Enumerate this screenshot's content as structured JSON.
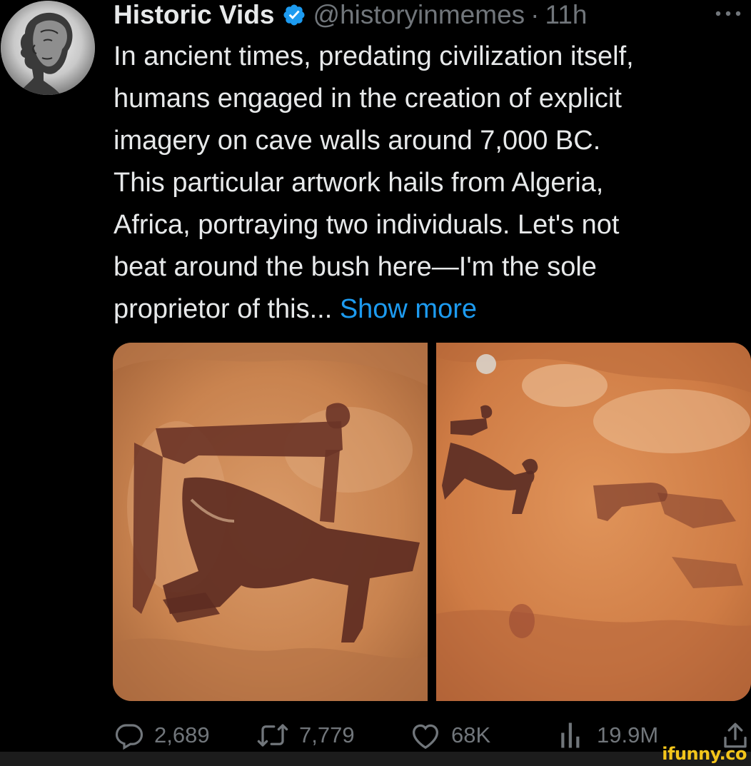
{
  "tweet": {
    "author": {
      "display_name": "Historic Vids",
      "handle": "@historyinmemes",
      "separator": "·",
      "time": "11h"
    },
    "text_lines": [
      "In ancient times, predating civilization itself,",
      "humans engaged in the creation of explicit",
      "imagery on cave walls around 7,000 BC.",
      "This particular artwork hails from Algeria,",
      "Africa, portraying two individuals. Let's not",
      "beat around the bush here—I'm the sole",
      "proprietor of this..."
    ],
    "show_more": "Show more",
    "stats": {
      "replies": "2,689",
      "retweets": "7,779",
      "likes": "68K",
      "views": "19.9M"
    }
  },
  "watermark": "ifunny.co",
  "colors": {
    "background": "#000000",
    "text": "#e7e9ea",
    "secondary_text": "#71767b",
    "link": "#1d9bf0",
    "verified": "#1d9bf0",
    "watermark": "#f3c51b"
  },
  "icons": [
    "avatar-portrait",
    "verified-badge-icon",
    "more-options-icon",
    "reply-icon",
    "retweet-icon",
    "like-icon",
    "views-icon",
    "share-icon"
  ]
}
